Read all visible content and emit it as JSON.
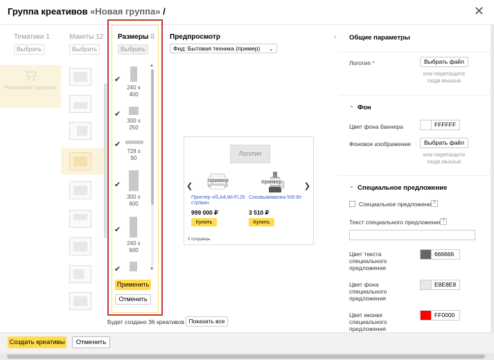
{
  "header": {
    "title": "Группа креативов",
    "group_name": "«Новая группа»",
    "edit_glyph": "/",
    "close_icon": "close-icon",
    "close_glyph": "✕"
  },
  "columns": {
    "themes": {
      "label": "Тематики",
      "count": "1",
      "select_label": "Выбрать",
      "item_label": "Розничная торговля",
      "item_icon": "shopping-cart-icon"
    },
    "layouts": {
      "label": "Макеты",
      "count": "12",
      "select_label": "Выбрать"
    },
    "sizes": {
      "label": "Размеры",
      "count": "8",
      "select_label": "Выбрать",
      "items": [
        {
          "label": "240 x 400",
          "checked": true
        },
        {
          "label": "300 x 250",
          "checked": true
        },
        {
          "label": "728 x 90",
          "checked": true
        },
        {
          "label": "300 x 600",
          "checked": true
        },
        {
          "label": "240 x 600",
          "checked": true
        }
      ],
      "apply_label": "Применить",
      "cancel_label": "Отменить"
    }
  },
  "preview": {
    "title": "Предпросмотр",
    "feed_select": "Фид: Бытовая техника (пример)",
    "logo_label": "Логотип",
    "example_tag": "пример",
    "products": [
      {
        "name": "Принтер ч/б,А4,Wi-Fi,25 стр/мин.",
        "price": "999 000 ₽",
        "buy_label": "Купить"
      },
      {
        "name": "Соковыжималка 500 Вт",
        "price": "3 510 ₽",
        "buy_label": "Купить"
      }
    ],
    "sales_label": "0 продавцы"
  },
  "settings": {
    "title": "Общие параметры",
    "logo": {
      "label": "Логотип",
      "required_mark": "*",
      "button": "Выбрать файл",
      "hint": "или перетащите сюда мышью"
    },
    "background": {
      "title": "Фон",
      "color_label": "Цвет фона баннера",
      "color_value": "FFFFFF",
      "color": "#ffffff",
      "image_label": "Фоновое изображение",
      "button": "Выбрать файл",
      "hint": "или перетащите сюда мышью"
    },
    "special": {
      "title": "Специальное предложение",
      "checkbox_label": "Специальное предложение",
      "text_label": "Текст специального предложения",
      "help_glyph": "?",
      "text_color_label": "Цвет текста специального предложения",
      "text_color_value": "666666",
      "text_color": "#666666",
      "bg_color_label": "Цвет фона специального предложения",
      "bg_color_value": "E8E8E8",
      "bg_color": "#e8e8e8",
      "icon_color_label": "Цвет иконки специального предложения",
      "icon_color_value": "FF0000",
      "icon_color": "#ff0000"
    }
  },
  "bottom": {
    "note": "Будет создано 36 креативов",
    "show_all": "Показать все",
    "create_label": "Создать креативы",
    "cancel_label": "Отменить"
  },
  "colors": {
    "accent": "#ffdb4d",
    "highlight_frame": "#c0392b",
    "selected_bg": "#fcf3dc"
  }
}
